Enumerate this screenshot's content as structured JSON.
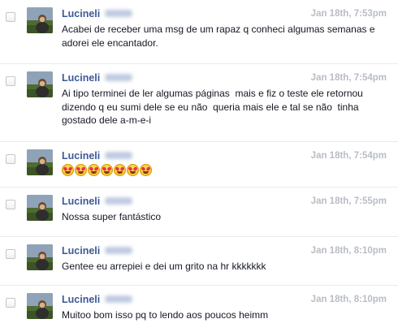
{
  "messages": [
    {
      "sender": "Lucineli",
      "time": "Jan 18th, 7:53pm",
      "text": "Acabei de receber uma msg de um rapaz q conheci algumas semanas e adorei ele encantador."
    },
    {
      "sender": "Lucineli",
      "time": "Jan 18th, 7:54pm",
      "text": "Ai tipo terminei de ler algumas páginas  mais e fiz o teste ele retornou dizendo q eu sumi dele se eu não  queria mais ele e tal se não  tinha gostado dele a-m-e-i"
    },
    {
      "sender": "Lucineli",
      "time": "Jan 18th, 7:54pm",
      "text": "",
      "emojis": [
        "heart-eyes-emoji",
        "heart-eyes-emoji",
        "heart-eyes-emoji",
        "heart-eyes-emoji",
        "heart-eyes-emoji",
        "heart-eyes-emoji",
        "heart-eyes-emoji"
      ]
    },
    {
      "sender": "Lucineli",
      "time": "Jan 18th, 7:55pm",
      "text": "Nossa super fantástico"
    },
    {
      "sender": "Lucineli",
      "time": "Jan 18th, 8:10pm",
      "text": "Gentee eu arrepiei e dei um grito na hr kkkkkkk"
    },
    {
      "sender": "Lucineli",
      "time": "Jan 18th, 8:10pm",
      "text": "Muitoo bom isso pq to lendo aos poucos heimm"
    }
  ]
}
